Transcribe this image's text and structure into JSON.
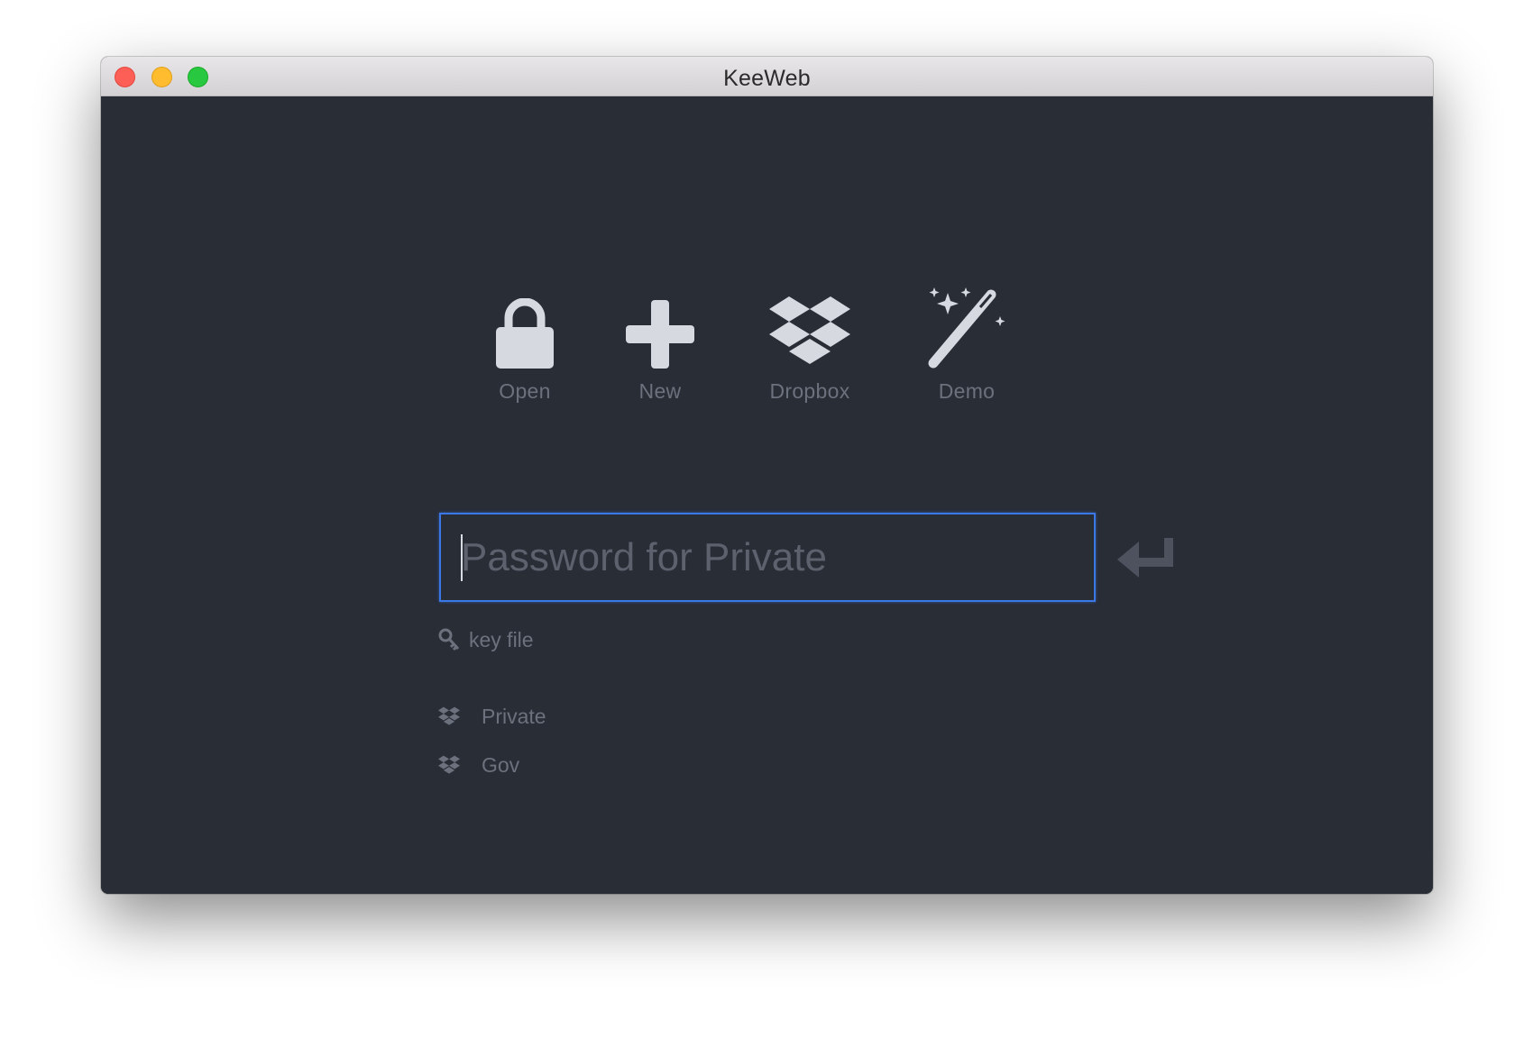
{
  "window": {
    "title": "KeeWeb"
  },
  "actions": [
    {
      "label": "Open",
      "icon": "lock-icon"
    },
    {
      "label": "New",
      "icon": "plus-icon"
    },
    {
      "label": "Dropbox",
      "icon": "dropbox-icon"
    },
    {
      "label": "Demo",
      "icon": "magic-wand-icon"
    }
  ],
  "password": {
    "placeholder": "Password for Private",
    "value": ""
  },
  "keyfile": {
    "label": "key file",
    "icon": "key-icon"
  },
  "files": [
    {
      "name": "Private",
      "icon": "dropbox-icon"
    },
    {
      "name": "Gov",
      "icon": "dropbox-icon"
    }
  ],
  "colors": {
    "background": "#292d36",
    "icon": "#d6d9e0",
    "muted_text": "#6c717e",
    "focus_border": "#3a78e8",
    "close": "#fd5f57",
    "minimize": "#febc2e",
    "zoom": "#28c840"
  }
}
